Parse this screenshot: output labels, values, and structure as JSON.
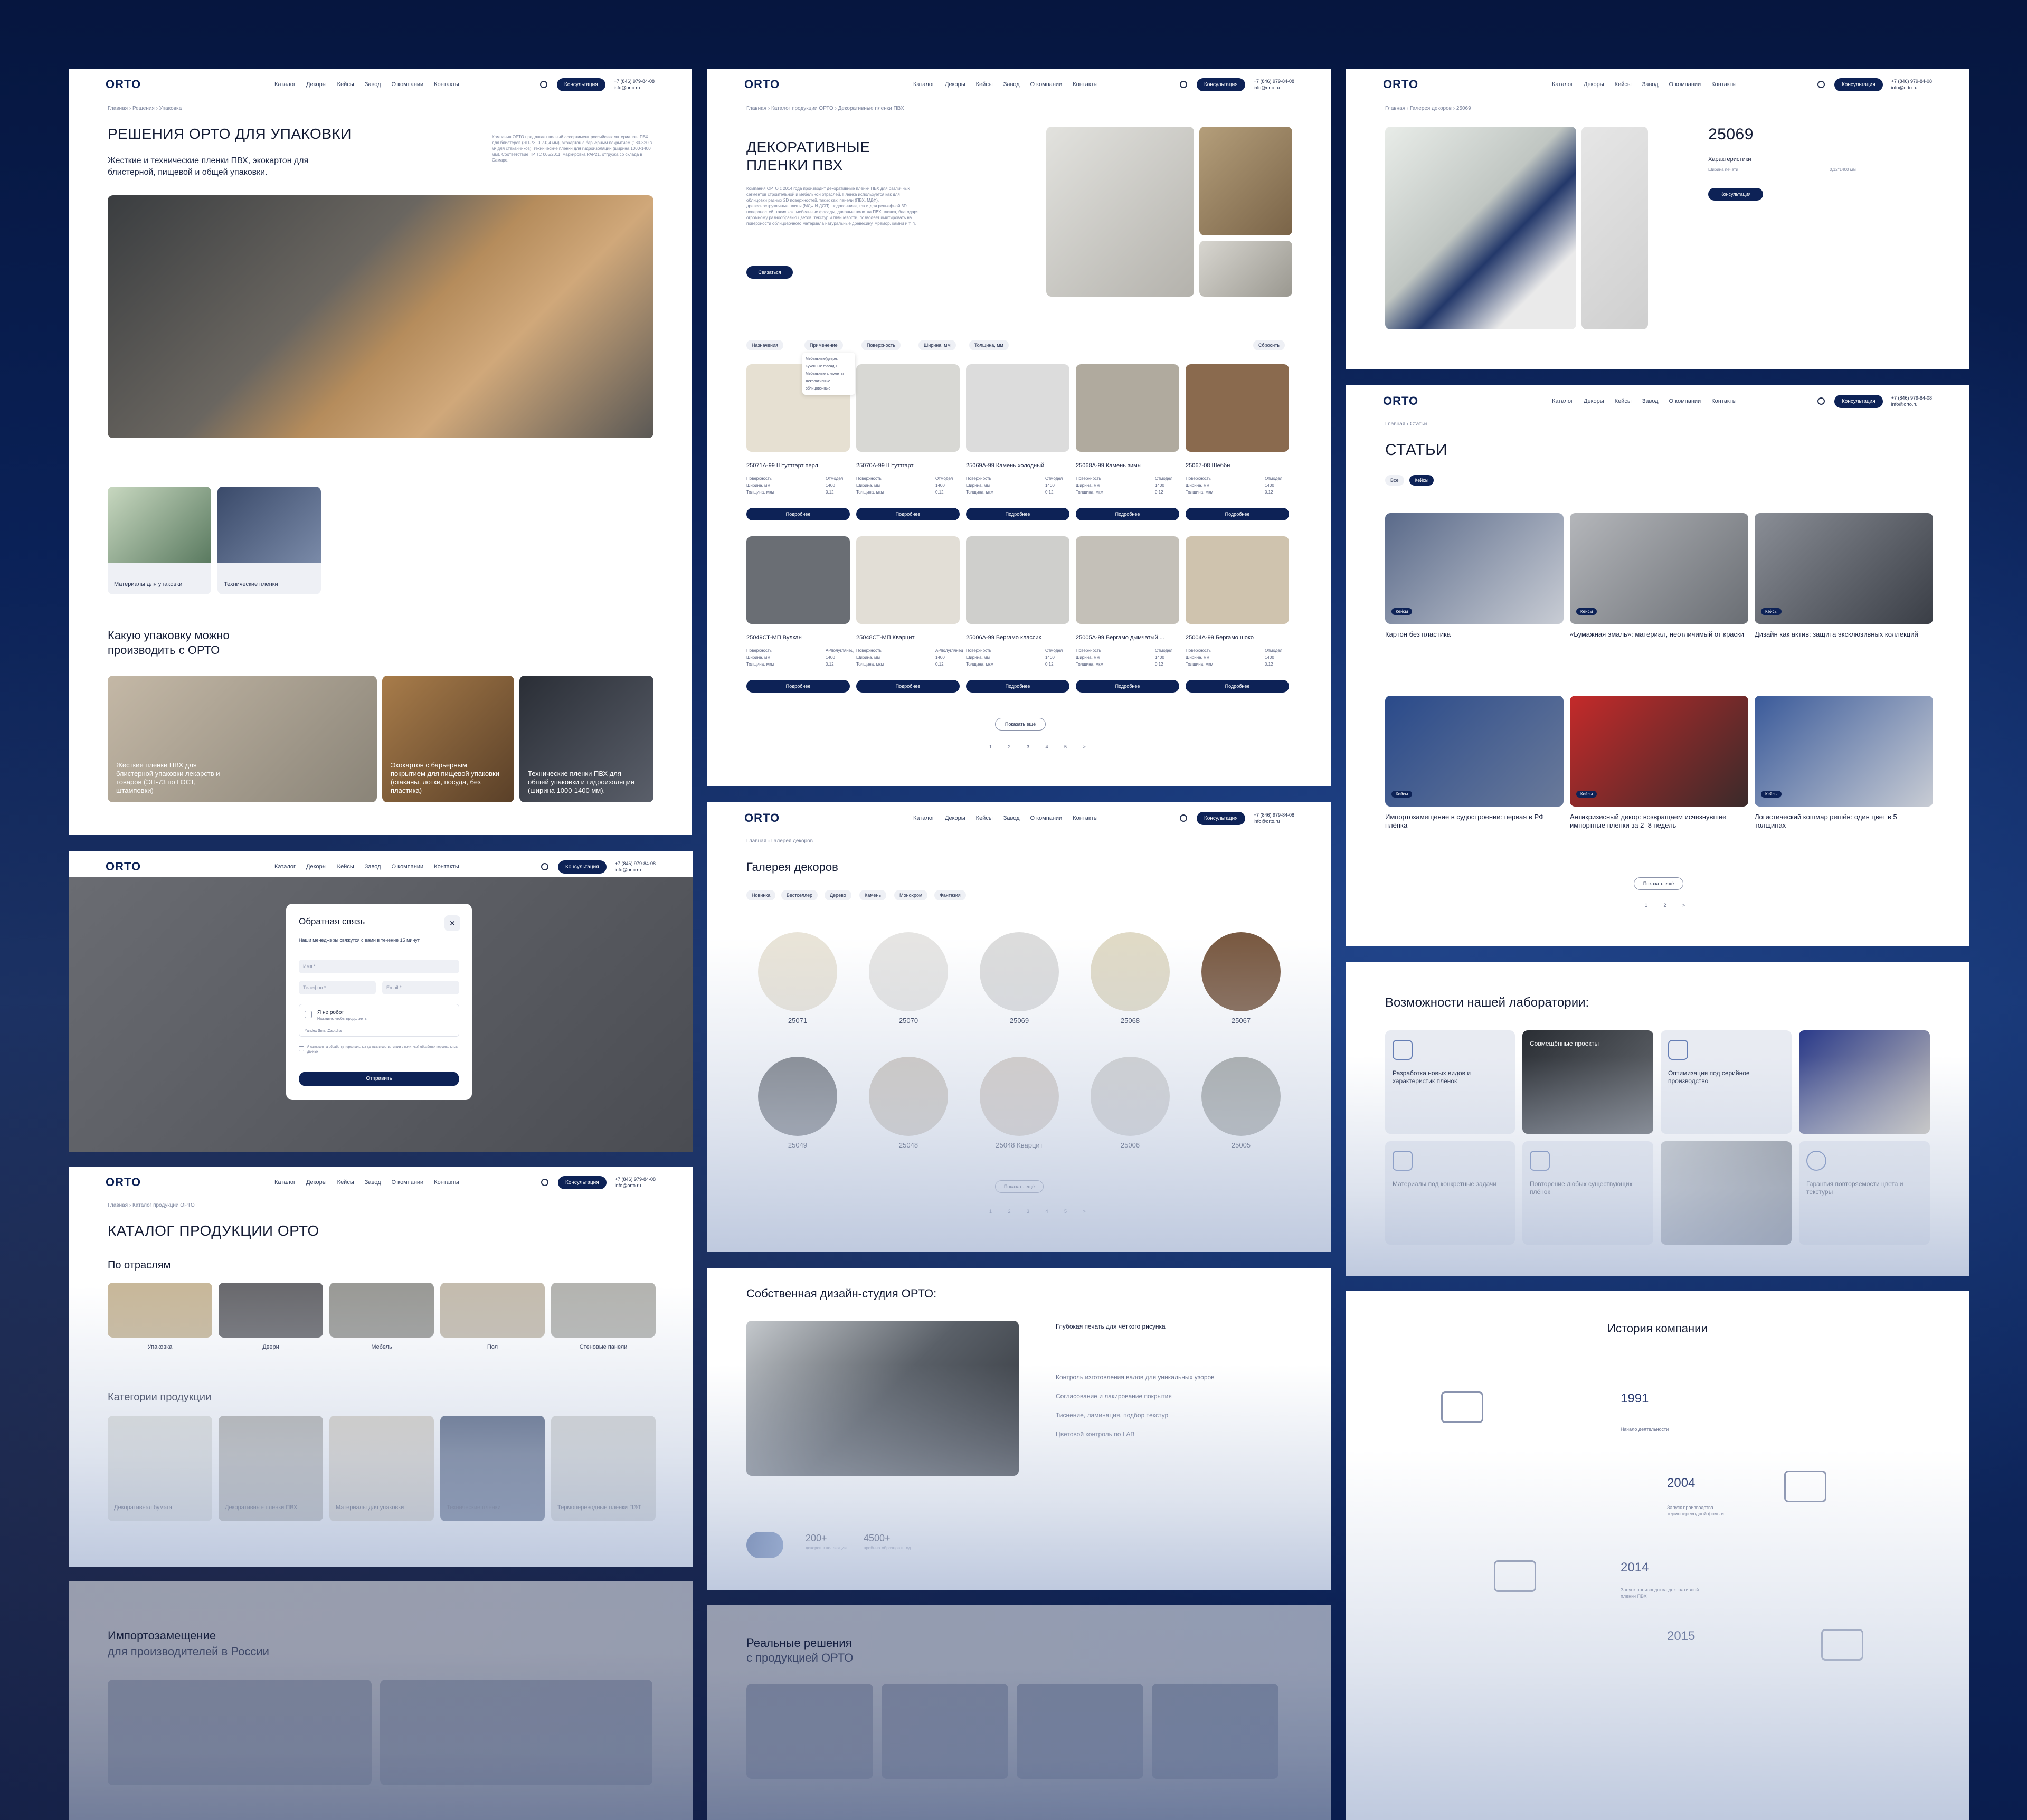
{
  "brand": {
    "logo": "ORTO",
    "nav": [
      "Каталог",
      "Декоры",
      "Кейсы",
      "Завод",
      "О компании",
      "Контакты"
    ],
    "cta": "Консультация",
    "phone": "+7 (846) 979-84-08",
    "email": "info@orto.ru"
  },
  "pack": {
    "crumb": "Главная › Решения › Упаковка",
    "title": "РЕШЕНИЯ ОРТО ДЛЯ УПАКОВКИ",
    "subtitle": "Жесткие и технические пленки ПВХ, экокартон для блистерной, пищевой и общей упаковки.",
    "desc": "Компания ОРТО предлагает полный ассортимент российских материалов: ПВХ для блистеров (ЭП-73, 0,2-0,4 мм), экокартон с барьерным покрытием (180-320 г/м² для стаканчиков), технические пленки для гидроизоляции (ширина 1000-1400 мм). Соответствие ТР ТС 005/2011, маркировка PAP21, отгрузка со склада в Самаре.",
    "cards": [
      "Материалы для упаковки",
      "Технические пленки"
    ],
    "q": "Какую упаковку можно производить с ОРТО",
    "big": [
      "Жесткие пленки ПВХ для блистерной упаковки лекарств и товаров (ЭП-73 по ГОСТ, штамповки)",
      "Экокартон с барьерным покрытием для пищевой упаковки (стаканы, лотки, посуда, без пластика)",
      "Технические пленки ПВХ для общей упаковки и гидроизоляции (ширина 1000-1400 мм)."
    ]
  },
  "films": {
    "crumb": "Главная › Каталог продукции ОРТО › Декоративные пленки ПВХ",
    "title": "ДЕКОРАТИВНЫЕ ПЛЕНКИ ПВХ",
    "desc": "Компания ОРТО с 2014 года производит декоративные пленки ПВХ для различных сегментов строительной и мебельной отраслей. Пленка используется как для облицовки разных 2D поверхностей, таких как: панели (ПВХ, МДФ), древесностружечные плиты (МДФ И ДСП), подоконники, так и для рельефной 3D поверхностей, таких как: мебельные фасады, дверные полотна ПВХ пленка, благодаря огромному разнообразию цветов, текстур и глянцевости, позволяет имитировать на поверхности облицовочного материала натуральные древесину, мрамор, камни и т. п.",
    "contact_btn": "Связаться",
    "filters": [
      "Назначения",
      "Применение",
      "Поверхность",
      "Ширина, мм",
      "Толщина, мм"
    ],
    "reset": "Сбросить",
    "dropdown": [
      "Мебельные/дверн.",
      "Кухонные фасады",
      "Мебельные элементы",
      "Декоративные облицовочные"
    ],
    "items": [
      {
        "name": "25071А-99 Штуттгарт перл"
      },
      {
        "name": "25070А-99 Штуттгарт"
      },
      {
        "name": "25069А-99 Камень холодный"
      },
      {
        "name": "25068А-99 Камень зимы"
      },
      {
        "name": "25067-08 Шебби"
      },
      {
        "name": "25049СТ-МП Вулкан"
      },
      {
        "name": "25048СТ-МП Кварцит"
      },
      {
        "name": "25006А-99 Бергамо классик"
      },
      {
        "name": "25005А-99 Бергамо дымчатый ..."
      },
      {
        "name": "25004А-99 Бергамо шоко"
      }
    ],
    "spec_labels": [
      "Поверхность",
      "Ширина, мм",
      "Толщина, мкм"
    ],
    "spec_vals": [
      [
        "Отмодел",
        "1400",
        "0.12"
      ],
      [
        "Отмодел",
        "1400",
        "0.12"
      ],
      [
        "Отмодел",
        "1400",
        "0.12"
      ],
      [
        "Отмодел",
        "1400",
        "0.12"
      ],
      [
        "Отмодел",
        "1400",
        "0.12"
      ],
      [
        "А-/полуглянец",
        "1400",
        "0.12"
      ],
      [
        "А-/полуглянец",
        "1400",
        "0.12"
      ],
      [
        "Отмодел",
        "1400",
        "0.12"
      ],
      [
        "Отмодел",
        "1400",
        "0.12"
      ],
      [
        "Отмодел",
        "1400",
        "0.12"
      ]
    ],
    "more": "Подробнее",
    "showmore": "Показать ещё",
    "pager": "1 2 3 4 5 >"
  },
  "decor": {
    "crumb": "Главная › Галерея декоров › 25069",
    "code": "25069",
    "char": "Характеристики",
    "spec": "Ширина печати",
    "specv": "0,12*1400 мм",
    "btn": "Консультация"
  },
  "articles": {
    "crumb": "Главная › Статьи",
    "title": "СТАТЬИ",
    "tabs": [
      "Все",
      "Кейсы"
    ],
    "badge": "Кейсы",
    "items": [
      "Картон без пластика",
      "«Бумажная эмаль»: материал, неотличимый от краски",
      "Дизайн как актив: защита эксклюзивных коллекций",
      "Импортозамещение в судостроении: первая в РФ плёнка",
      "Антикризисный декор: возвращаем исчезнувшие импортные пленки за 2–8 недель",
      "Логистический кошмар решён: один цвет в 5 толщинах"
    ],
    "showmore": "Показать ещё",
    "pager": "1 2 >"
  },
  "modal": {
    "title": "Обратная связь",
    "subtitle": "Наши менеджеры свяжутся с вами в течение 15 минут",
    "name": "Имя *",
    "phone": "Телефон *",
    "email": "Email *",
    "robot": "Я не робот",
    "robot_sub": "Нажмите, чтобы продолжить",
    "captcha": "Yandex SmartCaptcha",
    "agree": "Я согласен на обработку персональных данных в соответствии с политикой обработки персональных данных",
    "submit": "Отправить"
  },
  "gallery": {
    "crumb": "Главная › Галерея декоров",
    "title": "Галерея декоров",
    "chips": [
      "Новинка",
      "Бестселлер",
      "Дерево",
      "Камень",
      "Монохром",
      "Фантазия"
    ],
    "items": [
      "25071",
      "25070",
      "25069",
      "25068",
      "25067",
      "25049",
      "25048",
      "25048 Кварцит",
      "25006",
      "25005"
    ],
    "colors": [
      "#e9e4d8",
      "#e6e5e3",
      "#dcdcdc",
      "#e0dac6",
      "#7a5a42",
      "#6d7074",
      "#cfc6ba",
      "#d6ccc1",
      "#d2d0cc",
      "#9ea09a"
    ],
    "showmore": "Показать ещё",
    "pager": "1 2 3 4 5 >"
  },
  "catalog": {
    "crumb": "Главная › Каталог продукции ОРТО",
    "title": "КАТАЛОГ ПРОДУКЦИИ ОРТО",
    "h_ind": "По отраслям",
    "ind": [
      "Упаковка",
      "Двери",
      "Мебель",
      "Пол",
      "Стеновые панели"
    ],
    "h_cat": "Категории продукции",
    "cat": [
      "Декоративная бумага",
      "Декоративные пленки ПВХ",
      "Материалы для упаковки",
      "Технические пленки",
      "Термопереводные пленки ПЭТ"
    ]
  },
  "lab": {
    "title": "Возможности нашей лаборатории:",
    "cards": [
      "Разработка новых видов и характеристик плёнок",
      "Совмещённые проекты",
      "Оптимизация под серийное производство",
      "Материалы под конкретные задачи",
      "Повторение любых существующих плёнок",
      "Гарантия повторяемости цвета и текстуры"
    ]
  },
  "studio": {
    "title": "Собственная дизайн-студия ОРТО:",
    "items": [
      "Глубокая печать для чёткого рисунка",
      "Контроль изготовления валов для уникальных узоров",
      "Согласование и лакирование покрытия",
      "Тиснение, ламинация, подбор текстур",
      "Цветовой контроль по LAB"
    ],
    "stat1": "200+",
    "stat2": "4500+",
    "stat1s": "декоров в коллекции",
    "stat2s": "пробных образцов в год"
  },
  "history": {
    "title": "История компании",
    "years": [
      "1991",
      "2004",
      "2014",
      "2015"
    ],
    "y1": "Начало деятельности",
    "y2": "Запуск производства термопереводной фольги",
    "y3": "Запуск производства декоративной пленки ПВХ"
  },
  "import": {
    "title": "Импортозамещение",
    "sub": "для производителей в России"
  },
  "real": {
    "title": "Реальные решения",
    "sub": "с продукцией ОРТО"
  }
}
